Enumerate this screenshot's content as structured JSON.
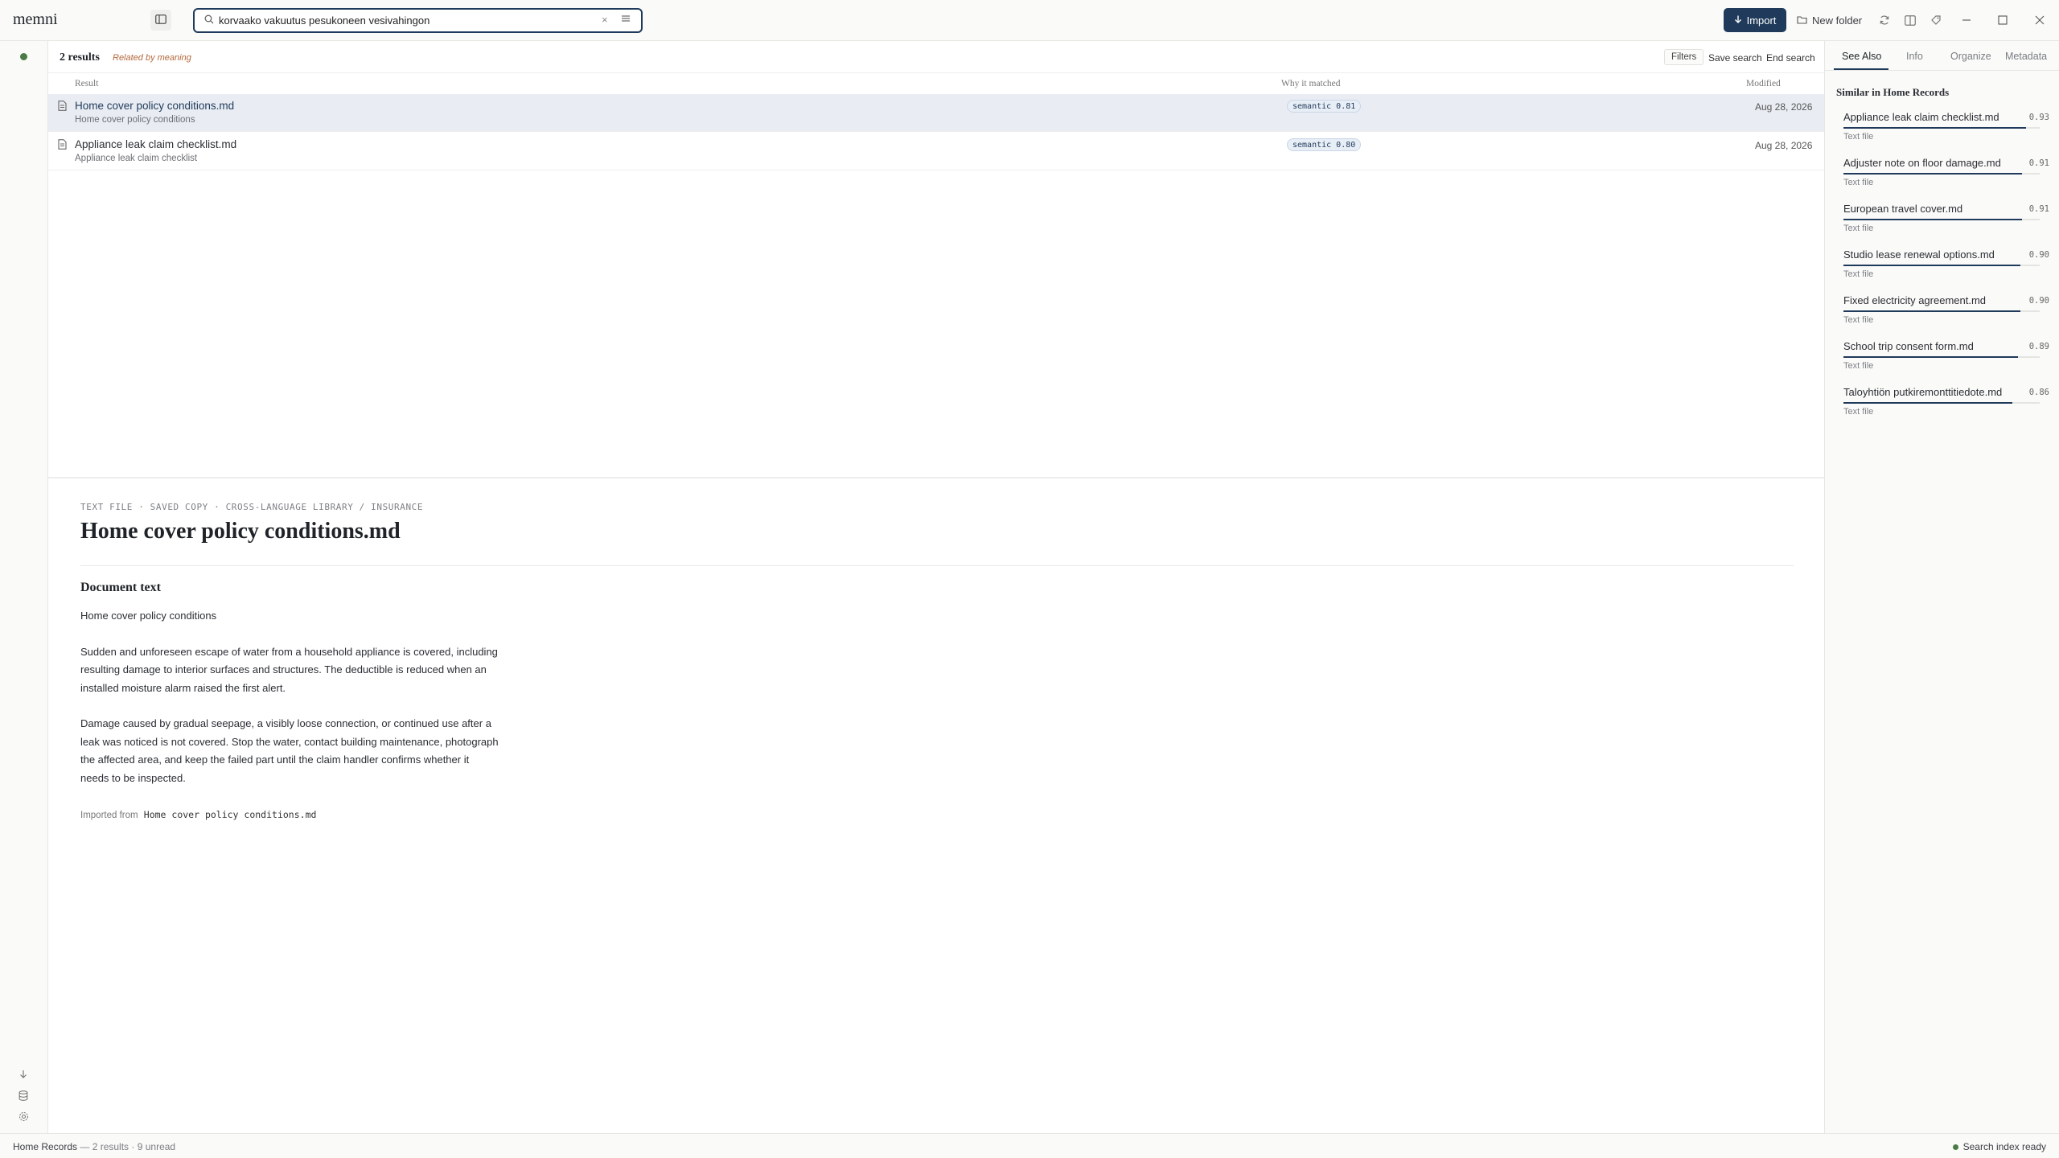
{
  "app": {
    "name": "memni"
  },
  "search": {
    "query": "korvaako vakuutus pesukoneen vesivahingon",
    "clear_glyph": "×"
  },
  "toolbar": {
    "import_label": "Import",
    "new_folder_label": "New folder"
  },
  "results": {
    "count_label": "2 results",
    "mode_label": "Related by meaning",
    "filters_label": "Filters",
    "save_search_label": "Save search",
    "end_search_label": "End search",
    "columns": {
      "result": "Result",
      "why": "Why it matched",
      "modified": "Modified"
    },
    "rows": [
      {
        "title": "Home cover policy conditions.md",
        "subtitle": "Home cover policy conditions",
        "match": "semantic 0.81",
        "modified": "Aug 28, 2026",
        "selected": true
      },
      {
        "title": "Appliance leak claim checklist.md",
        "subtitle": "Appliance leak claim checklist",
        "match": "semantic 0.80",
        "modified": "Aug 28, 2026",
        "selected": false
      }
    ]
  },
  "preview": {
    "breadcrumb": "TEXT FILE · SAVED COPY · CROSS-LANGUAGE LIBRARY / INSURANCE",
    "title": "Home cover policy conditions.md",
    "section_heading": "Document text",
    "paragraphs": [
      "Home cover policy conditions",
      "Sudden and unforeseen escape of water from a household appliance is covered, including resulting damage to interior surfaces and structures. The deductible is reduced when an installed moisture alarm raised the first alert.",
      "Damage caused by gradual seepage, a visibly loose connection, or continued use after a leak was noticed is not covered. Stop the water, contact building maintenance, photograph the affected area, and keep the failed part until the claim handler confirms whether it needs to be inspected."
    ],
    "source_prefix": "Imported from",
    "source_file": "Home cover policy conditions.md"
  },
  "right_panel": {
    "tabs": [
      "See Also",
      "Info",
      "Organize",
      "Metadata"
    ],
    "active_tab": "See Also",
    "heading": "Similar in Home Records",
    "items": [
      {
        "name": "Appliance leak claim checklist.md",
        "score": "0.93",
        "type": "Text file",
        "fraction": 0.93
      },
      {
        "name": "Adjuster note on floor damage.md",
        "score": "0.91",
        "type": "Text file",
        "fraction": 0.91
      },
      {
        "name": "European travel cover.md",
        "score": "0.91",
        "type": "Text file",
        "fraction": 0.91
      },
      {
        "name": "Studio lease renewal options.md",
        "score": "0.90",
        "type": "Text file",
        "fraction": 0.9
      },
      {
        "name": "Fixed electricity agreement.md",
        "score": "0.90",
        "type": "Text file",
        "fraction": 0.9
      },
      {
        "name": "School trip consent form.md",
        "score": "0.89",
        "type": "Text file",
        "fraction": 0.89
      },
      {
        "name": "Taloyhtiön putkiremonttitiedote.md",
        "score": "0.86",
        "type": "Text file",
        "fraction": 0.86
      }
    ]
  },
  "statusbar": {
    "library": "Home Records",
    "summary": " — 2 results · 9 unread",
    "index_status": "Search index ready"
  },
  "colors": {
    "accent": "#1f3a5a",
    "status_green": "#4a7a45",
    "mode_label": "#b3693c"
  }
}
